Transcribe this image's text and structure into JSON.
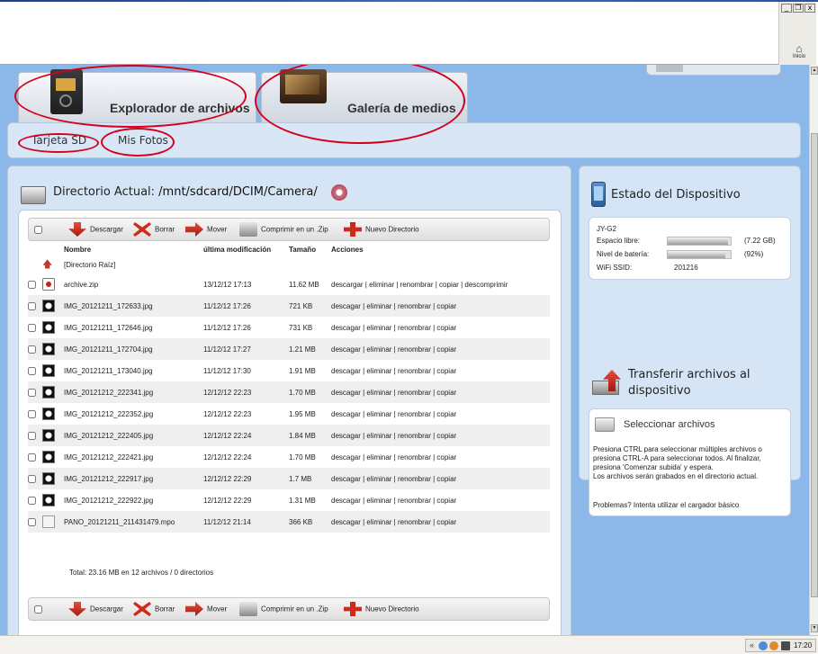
{
  "window": {
    "minimize_glyph": "_",
    "restore_glyph": "❐",
    "close_glyph": "x",
    "home_label": "Inicio",
    "home_icon": "home-icon"
  },
  "tabs": [
    {
      "label": "Explorador de archivos",
      "icon": "sd-card-icon"
    },
    {
      "label": "Galería de medios",
      "icon": "gallery-icon"
    }
  ],
  "breadcrumb": [
    {
      "label": "Tarjeta SD"
    },
    {
      "label": "Mis Fotos"
    }
  ],
  "directory": {
    "prefix": "Directorio Actual: ",
    "path": "/mnt/sdcard/DCIM/Camera/"
  },
  "toolbar": {
    "download": "Descargar",
    "delete": "Borrar",
    "move": "Mover",
    "zip": "Comprimir en un .Zip",
    "new_dir": "Nuevo Directorio"
  },
  "table": {
    "headers": [
      "Nombre",
      "última modificación",
      "Tamaño",
      "Acciones"
    ],
    "parent_label": "[Directorio Raíz]",
    "rows": [
      {
        "name": "archive.zip",
        "modified": "13/12/12 17:13",
        "size": "11.62 MB",
        "actions": "descargar | eliminar | renombrar | copiar | descomprimir",
        "thumb": "zip"
      },
      {
        "name": "IMG_20121211_172633.jpg",
        "modified": "11/12/12 17:26",
        "size": "721 KB",
        "actions": "descagar | eliminar | renombrar | copiar",
        "thumb": "img"
      },
      {
        "name": "IMG_20121211_172646.jpg",
        "modified": "11/12/12 17:26",
        "size": "731 KB",
        "actions": "descagar | eliminar | renombrar | copiar",
        "thumb": "img"
      },
      {
        "name": "IMG_20121211_172704.jpg",
        "modified": "11/12/12 17:27",
        "size": "1.21 MB",
        "actions": "descagar | eliminar | renombrar | copiar",
        "thumb": "img"
      },
      {
        "name": "IMG_20121211_173040.jpg",
        "modified": "11/12/12 17:30",
        "size": "1.91 MB",
        "actions": "descagar | eliminar | renombrar | copiar",
        "thumb": "img"
      },
      {
        "name": "IMG_20121212_222341.jpg",
        "modified": "12/12/12 22:23",
        "size": "1.70 MB",
        "actions": "descagar | eliminar | renombrar | copiar",
        "thumb": "img"
      },
      {
        "name": "IMG_20121212_222352.jpg",
        "modified": "12/12/12 22:23",
        "size": "1.95 MB",
        "actions": "descagar | eliminar | renombrar | copiar",
        "thumb": "img"
      },
      {
        "name": "IMG_20121212_222405.jpg",
        "modified": "12/12/12 22:24",
        "size": "1.84 MB",
        "actions": "descagar | eliminar | renombrar | copiar",
        "thumb": "img"
      },
      {
        "name": "IMG_20121212_222421.jpg",
        "modified": "12/12/12 22:24",
        "size": "1.70 MB",
        "actions": "descagar | eliminar | renombrar | copiar",
        "thumb": "img"
      },
      {
        "name": "IMG_20121212_222917.jpg",
        "modified": "12/12/12 22:29",
        "size": "1.7 MB",
        "actions": "descagar | eliminar | renombrar | copiar",
        "thumb": "img"
      },
      {
        "name": "IMG_20121212_222922.jpg",
        "modified": "12/12/12 22:29",
        "size": "1.31 MB",
        "actions": "descagar | eliminar | renombrar | copiar",
        "thumb": "img"
      },
      {
        "name": "PANO_20121211_211431479.mpo",
        "modified": "11/12/12 21:14",
        "size": "366 KB",
        "actions": "descagar | eliminar | renombrar | copiar",
        "thumb": "doc"
      }
    ],
    "total": "Total: 23.16 MB en 12 archivos / 0 directorios"
  },
  "device": {
    "title": "Estado del Dispositivo",
    "name": "JY-G2",
    "free_label": "Espacio libre:",
    "free_value": "(7.22 GB)",
    "free_fraction": 0.96,
    "battery_label": "Nivel de batería:",
    "battery_value": "(92%)",
    "battery_fraction": 0.92,
    "wifi_label": "WiFi SSID:",
    "wifi_value": "201216"
  },
  "transfer": {
    "title": "Transferir archivos al dispositivo",
    "select_label": "Seleccionar archivos",
    "help": "Presiona CTRL para seleccionar múltiples archivos o presiona CTRL-A para seleccionar todos. Al finalizar, presiona 'Comenzar subida' y espera.\nLos archivos serán grabados en el directorio actual.",
    "problems": "Problemas? Intenta utilizar el cargador básico"
  },
  "taskbar": {
    "clock": "17:20",
    "tray_arrow": "«"
  },
  "colors": {
    "app_background": "#8bb8e9",
    "panel": "#d6e5f5",
    "annotation": "#d4001c",
    "accent_red": "#cf2b1d"
  }
}
